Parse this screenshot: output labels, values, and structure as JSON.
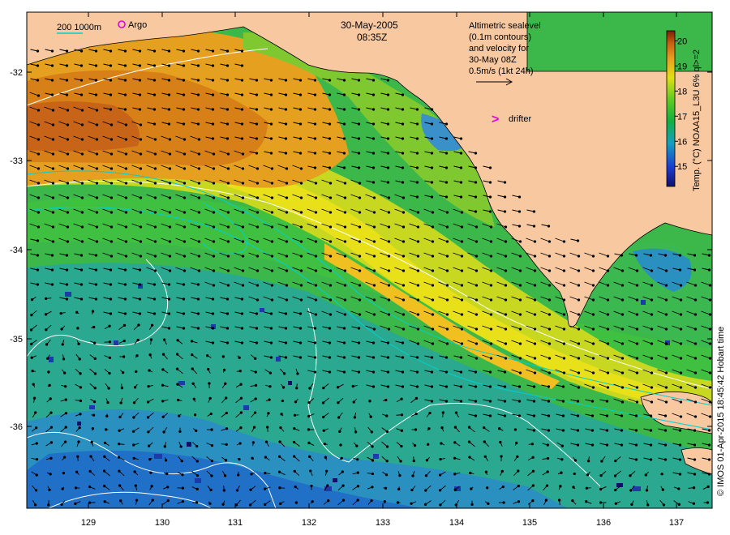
{
  "map": {
    "date": "30-May-2005",
    "time": "08:35Z",
    "longitude_ticks": [
      "129",
      "130",
      "131",
      "132",
      "133",
      "134",
      "135",
      "136",
      "137"
    ],
    "latitude_ticks": [
      "-32",
      "-33",
      "-34",
      "-35",
      "-36"
    ]
  },
  "legend": {
    "contour_depths": "200  1000m",
    "argo_label": "Argo",
    "drifter_label": "drifter",
    "drifter_glyph": ">",
    "altimetry_lines": [
      "Altimetric sealevel",
      "(0.1m contours)",
      "and velocity for",
      "30-May 08Z",
      "0.5m/s (1kt 24h)"
    ]
  },
  "colorbar": {
    "title": "Temp. (°C) NOAA15_L3U 6% ql>=2",
    "tick_labels": [
      "20",
      "19",
      "18",
      "17",
      "16",
      "15"
    ],
    "min": 14.2,
    "max": 20.4,
    "ticks": [
      20,
      19,
      18,
      17,
      16,
      15
    ]
  },
  "credit": "© IMOS 01-Apr-2015 18:45:42 Hobart time",
  "colors": {
    "land": "#f8c8a0",
    "contour_200": "#00d0d0",
    "contour_sealevel": "#ffffff",
    "argo": "#e000e0",
    "drifter": "#e000e0"
  }
}
